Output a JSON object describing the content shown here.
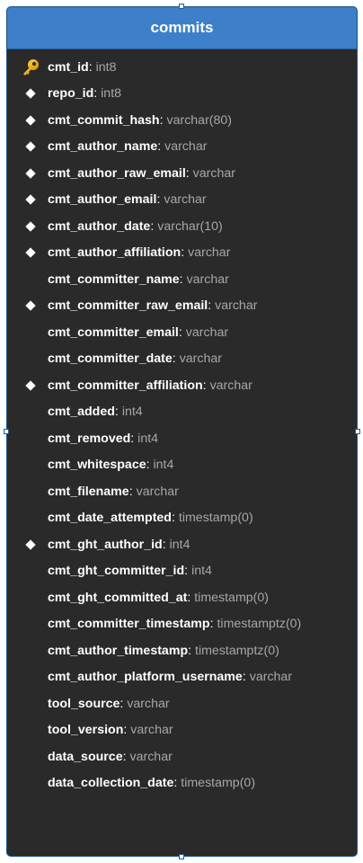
{
  "table": {
    "title": "commits",
    "header_color": "#3d80c9",
    "body_color": "#2a2a2a",
    "columns": [
      {
        "name": "cmt_id",
        "type": "int8",
        "marker": "key"
      },
      {
        "name": "repo_id",
        "type": "int8",
        "marker": "diamond"
      },
      {
        "name": "cmt_commit_hash",
        "type": "varchar(80)",
        "marker": "diamond"
      },
      {
        "name": "cmt_author_name",
        "type": "varchar",
        "marker": "diamond"
      },
      {
        "name": "cmt_author_raw_email",
        "type": "varchar",
        "marker": "diamond"
      },
      {
        "name": "cmt_author_email",
        "type": "varchar",
        "marker": "diamond"
      },
      {
        "name": "cmt_author_date",
        "type": "varchar(10)",
        "marker": "diamond"
      },
      {
        "name": "cmt_author_affiliation",
        "type": "varchar",
        "marker": "diamond"
      },
      {
        "name": "cmt_committer_name",
        "type": "varchar",
        "marker": "none"
      },
      {
        "name": "cmt_committer_raw_email",
        "type": "varchar",
        "marker": "diamond"
      },
      {
        "name": "cmt_committer_email",
        "type": "varchar",
        "marker": "none"
      },
      {
        "name": "cmt_committer_date",
        "type": "varchar",
        "marker": "none"
      },
      {
        "name": "cmt_committer_affiliation",
        "type": "varchar",
        "marker": "diamond"
      },
      {
        "name": "cmt_added",
        "type": "int4",
        "marker": "none"
      },
      {
        "name": "cmt_removed",
        "type": "int4",
        "marker": "none"
      },
      {
        "name": "cmt_whitespace",
        "type": "int4",
        "marker": "none"
      },
      {
        "name": "cmt_filename",
        "type": "varchar",
        "marker": "none"
      },
      {
        "name": "cmt_date_attempted",
        "type": "timestamp(0)",
        "marker": "none"
      },
      {
        "name": "cmt_ght_author_id",
        "type": "int4",
        "marker": "diamond"
      },
      {
        "name": "cmt_ght_committer_id",
        "type": "int4",
        "marker": "none"
      },
      {
        "name": "cmt_ght_committed_at",
        "type": "timestamp(0)",
        "marker": "none"
      },
      {
        "name": "cmt_committer_timestamp",
        "type": "timestamptz(0)",
        "marker": "none"
      },
      {
        "name": "cmt_author_timestamp",
        "type": "timestamptz(0)",
        "marker": "none"
      },
      {
        "name": "cmt_author_platform_username",
        "type": "varchar",
        "marker": "none"
      },
      {
        "name": "tool_source",
        "type": "varchar",
        "marker": "none"
      },
      {
        "name": "tool_version",
        "type": "varchar",
        "marker": "none"
      },
      {
        "name": "data_source",
        "type": "varchar",
        "marker": "none"
      },
      {
        "name": "data_collection_date",
        "type": "timestamp(0)",
        "marker": "none"
      }
    ]
  },
  "separator": ":"
}
